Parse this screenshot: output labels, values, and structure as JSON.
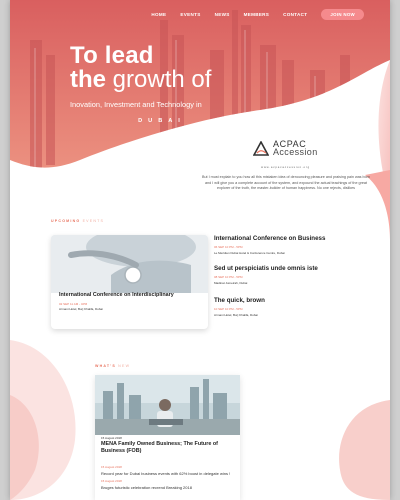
{
  "nav": {
    "links": [
      "HOME",
      "EVENTS",
      "NEWS",
      "MEMBERS",
      "CONTACT"
    ],
    "cta": "JOIN NOW"
  },
  "hero": {
    "line1": "To lead",
    "line2_bold": "the",
    "line2_light": "growth of",
    "subtitle": "Inovation, Investment and Technology in",
    "city": "DUBAI"
  },
  "brand": {
    "name": "ACPAC",
    "sub": "Accession",
    "url": "www.acpacaccession.org"
  },
  "about": {
    "text": "But I must explain to you how all this mistaken idea of denouncing pleasure and praising pain was born and I will give you a complete account of the system, and expound the actual teachings of the great explorer of the truth, the master-builder of human happiness. No one rejects, dislikes"
  },
  "upcoming": {
    "label_strong": "UPCOMING",
    "label_muted": "EVENTS",
    "featured": {
      "title": "International Conference on Interdisciplinary",
      "date": "02 SEP 11 AM - 4PM",
      "venue": "Armani Hotel, Burj Khalifa, Dubai"
    },
    "events": [
      {
        "title": "International Conference on Business",
        "date": "06 SEP 10 PM - 5PM",
        "venue": "Le Meridien Dubai Hotel & Conference Centre, Dubai"
      },
      {
        "title": "Sed ut perspiciatis unde omnis iste",
        "date": "08 SEP 10 PM - 5PM",
        "venue": "Madinat Jumeirah, Dubai"
      },
      {
        "title": "The quick, brown",
        "date": "10 SEP 10 PM - 5PM",
        "venue": "Armani Hotel, Burj Khalifa, Dubai"
      }
    ]
  },
  "news": {
    "label_strong": "WHAT'S",
    "label_muted": "NEW",
    "main_date": "15 August 2018",
    "main_title": "MENA Family Owned Business; The Future of Business (FOB)",
    "item2_date": "15 August 2018",
    "item2_text": "Record year for Dubai business events with 62% boost in delegate wins !",
    "item3_date": "15 August 2018",
    "item3_text": "Bruges futuristic celebration recrend Breaking 2018"
  },
  "colors": {
    "accent": "#e8735f",
    "hero_overlay": "#e97777",
    "button": "#f58a8d"
  }
}
